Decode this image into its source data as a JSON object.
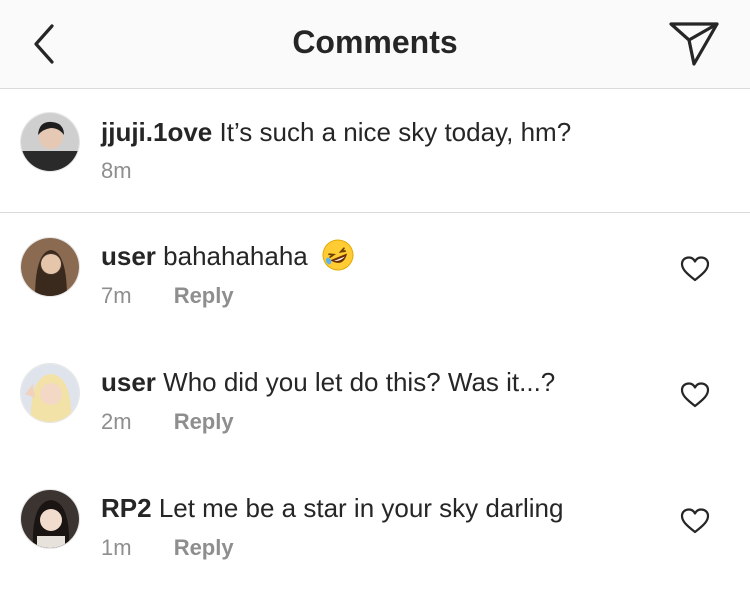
{
  "header": {
    "title": "Comments",
    "back_icon": "chevron-left-icon",
    "share_icon": "paper-plane-icon"
  },
  "caption": {
    "username": "jjuji.1ove",
    "text": "It’s such a nice sky today, hm?",
    "time": "8m"
  },
  "comments": [
    {
      "username": "user",
      "text": "bahahahaha",
      "emoji": "rolling-on-floor-laughing-emoji",
      "time": "7m",
      "reply_label": "Reply"
    },
    {
      "username": "user",
      "text": "Who did you let do this? Was it...?",
      "time": "2m",
      "reply_label": "Reply"
    },
    {
      "username": "RP2",
      "text": "Let me be a star in your sky darling",
      "time": "1m",
      "reply_label": "Reply"
    }
  ],
  "colors": {
    "text": "#262626",
    "secondary": "#8e8e8e",
    "divider": "#dbdbdb",
    "header_bg": "#fafafa"
  }
}
